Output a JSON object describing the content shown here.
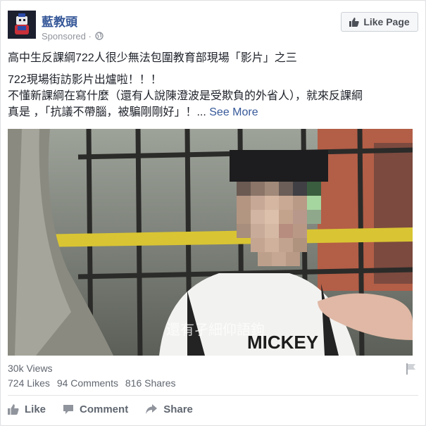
{
  "page": {
    "name": "藍教頭",
    "sponsored": "Sponsored ·"
  },
  "like_page_label": "Like Page",
  "post": {
    "line1": "高中生反課綱722人很少無法包圍教育部現場「影片」之三",
    "line2": "722現場街訪影片出爐啦！！！",
    "line3": "不懂新課綱在寫什麼（還有人說陳澄波是受欺負的外省人），就來反課綱",
    "line4_prefix": "真是 ，「抗議不帶腦，被騙剛剛好」！...",
    "see_more": "See More"
  },
  "video": {
    "subtitle": "還有孑細仰語鉤",
    "shirt_text": "MICKEY"
  },
  "stats": {
    "views": "30k Views",
    "likes": "724 Likes",
    "comments": "94 Comments",
    "shares": "816 Shares"
  },
  "actions": {
    "like": "Like",
    "comment": "Comment",
    "share": "Share"
  },
  "colors": {
    "link": "#365899",
    "muted": "#90949c",
    "tape": "#d9c533"
  }
}
